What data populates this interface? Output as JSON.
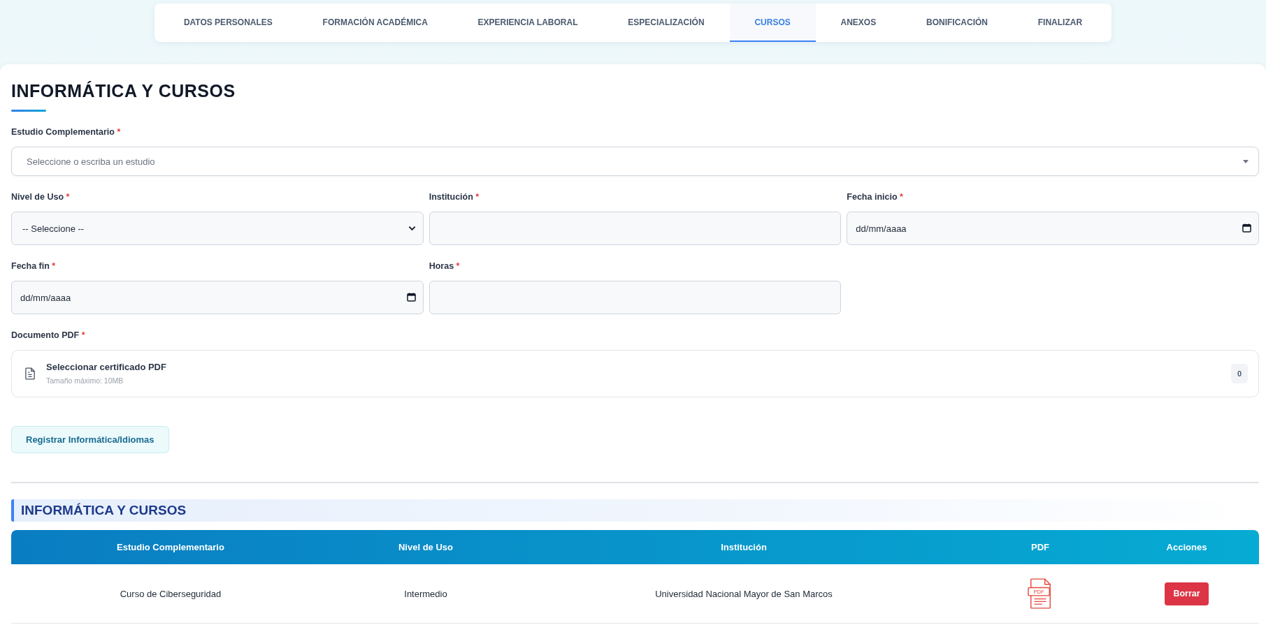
{
  "tabs": [
    {
      "label": "DATOS PERSONALES",
      "selected": false
    },
    {
      "label": "FORMACIÓN ACADÉMICA",
      "selected": false
    },
    {
      "label": "EXPERIENCIA LABORAL",
      "selected": false
    },
    {
      "label": "ESPECIALIZACIÓN",
      "selected": false
    },
    {
      "label": "CURSOS",
      "selected": true
    },
    {
      "label": "ANEXOS",
      "selected": false
    },
    {
      "label": "BONIFICACIÓN",
      "selected": false
    },
    {
      "label": "FINALIZAR",
      "selected": false
    }
  ],
  "form": {
    "title": "INFORMÁTICA Y CURSOS",
    "fields": [
      {
        "kind": "combobox",
        "label": "Estudio Complementario",
        "required_mark": "*",
        "placeholder": "Seleccione o escriba un estudio"
      },
      {
        "kind": "select",
        "label": "Nivel de Uso",
        "required_mark": "*",
        "value": "-- Seleccione --"
      },
      {
        "kind": "text",
        "label": "Institución",
        "required_mark": "*"
      },
      {
        "kind": "date",
        "label": "Fecha inicio",
        "required_mark": "*",
        "placeholder": "dd/mm/aaaa"
      },
      {
        "kind": "date",
        "label": "Fecha fin",
        "required_mark": "*",
        "placeholder": "dd/mm/aaaa"
      },
      {
        "kind": "text",
        "label": "Horas",
        "required_mark": "*"
      },
      {
        "kind": "file",
        "label": "Documento PDF",
        "required_mark": "*",
        "prompt": "Seleccionar certificado PDF",
        "hint": "Tamaño máximo: 10MB",
        "count": "0"
      }
    ],
    "submit_button": "Registrar Informática/Idiomas"
  },
  "records": {
    "title": "INFORMÁTICA Y CURSOS",
    "columns": [
      "Estudio Complementario",
      "Nivel de Uso",
      "Institución",
      "PDF",
      "Acciones"
    ],
    "rows": [
      {
        "cells": [
          "Curso de Ciberseguridad",
          "Intermedio",
          "Universidad Nacional Mayor de San Marcos"
        ],
        "pdf_label": "PDF",
        "action": "Borrar"
      }
    ]
  }
}
